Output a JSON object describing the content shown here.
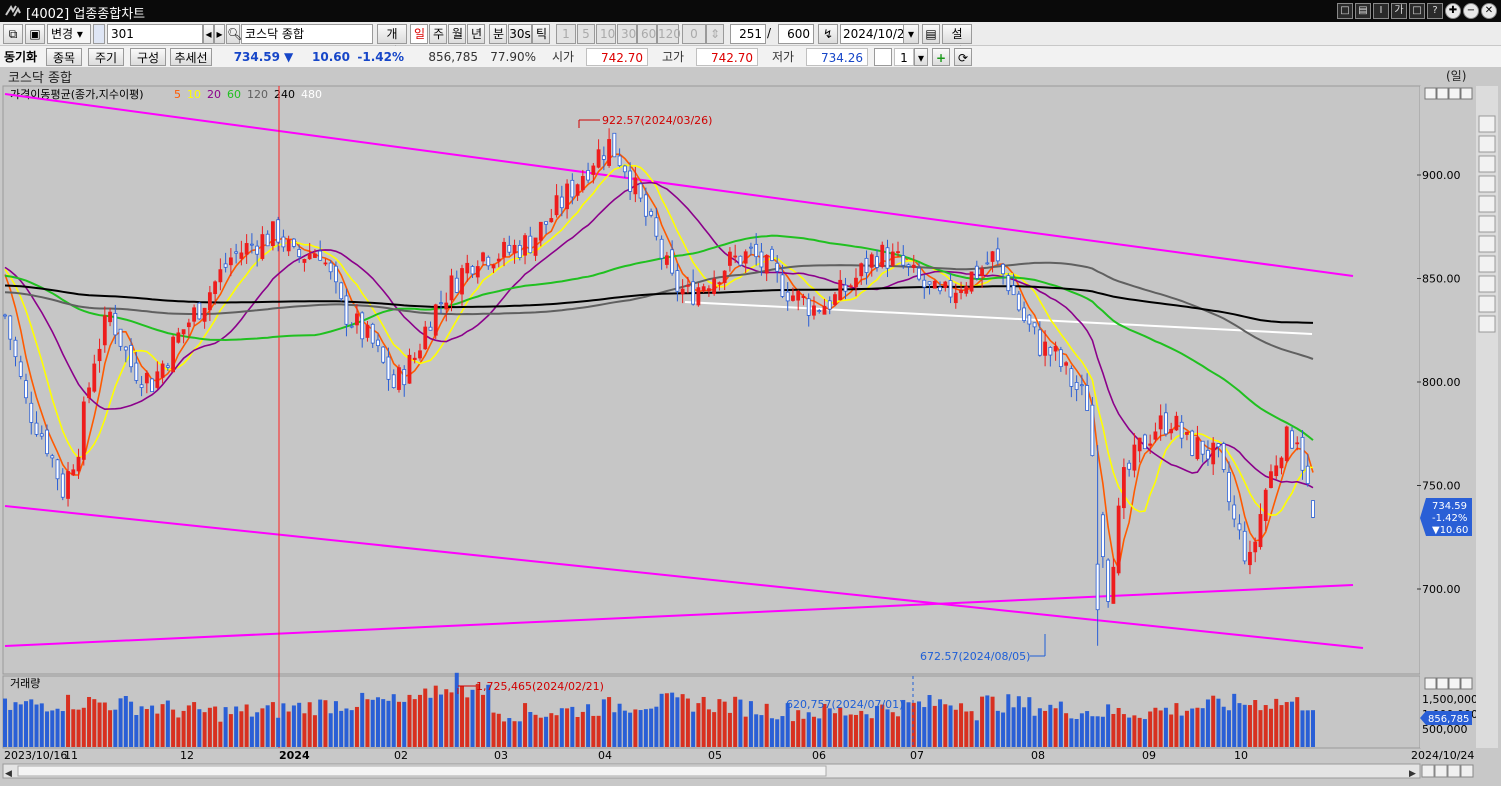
{
  "window": {
    "title": "[4002] 업종종합차트",
    "buttons": [
      "□",
      "▤",
      "Ⅰ",
      "가",
      "□",
      "?"
    ]
  },
  "toolbar": {
    "mode_label": "변경",
    "code_value": "301",
    "index_name": "코스닥 종합",
    "individual_label": "개별",
    "periods": [
      "일",
      "주",
      "월",
      "년",
      "분",
      "30s",
      "틱"
    ],
    "active_period": "일",
    "intervals": [
      "1",
      "5",
      "10",
      "30",
      "60",
      "120"
    ],
    "count_zero": "0",
    "count_display": "251",
    "count_total": "600",
    "date_value": "2024/10/24",
    "settings_label": "설정"
  },
  "quote_bar": {
    "sync_label": "동기화",
    "item_button": "종목",
    "period_button": "주기",
    "compose_button": "구성",
    "trendline_button": "추세선",
    "price": "734.59",
    "direction": "▼",
    "change": "10.60",
    "change_pct": "-1.42%",
    "volume": "856,785",
    "ratio": "77.90%",
    "open_label": "시가",
    "open": "742.70",
    "high_label": "고가",
    "high": "742.70",
    "low_label": "저가",
    "low": "734.26",
    "multiplier": "1"
  },
  "chart_header": {
    "title": "코스닥 종합",
    "unit": "(일)",
    "ma_legend_label": "가격이동평균(종가,지수이평)",
    "ma_periods": [
      {
        "label": "5",
        "color": "#ff5a00"
      },
      {
        "label": "10",
        "color": "#ffff00"
      },
      {
        "label": "20",
        "color": "#8b008b"
      },
      {
        "label": "60",
        "color": "#20c020"
      },
      {
        "label": "120",
        "color": "#606060"
      },
      {
        "label": "240",
        "color": "#000000"
      },
      {
        "label": "480",
        "color": "#ffffff"
      }
    ],
    "volume_label": "거래량"
  },
  "chart_data": {
    "type": "candlestick",
    "price_ylim": [
      665,
      930
    ],
    "price_ticks": [
      "900.00",
      "850.00",
      "800.00",
      "750.00",
      "700.00"
    ],
    "volume_ticks": [
      "1,500,000",
      "1,000,000",
      "500,000"
    ],
    "x_labels": [
      "2023/10/16",
      "11",
      "12",
      "2024",
      "02",
      "03",
      "04",
      "05",
      "06",
      "07",
      "08",
      "09",
      "10"
    ],
    "x_end_label": "2024/10/24",
    "annotations": [
      {
        "text": "922.57(2024/03/26)",
        "color": "#d00000"
      },
      {
        "text": "672.57(2024/08/05)",
        "color": "#1f5fd6"
      },
      {
        "text": "1,725,465(2024/02/21)",
        "color": "#d00000"
      },
      {
        "text": "620,757(2024/07/01)",
        "color": "#1f5fd6"
      }
    ],
    "last_price_box": [
      "734.59",
      "-1.42%",
      "▼10.60"
    ],
    "last_volume_box": "856,785",
    "monthly_closes": [
      {
        "x": "2023/10/16",
        "close": 790
      },
      {
        "x": "2023/11",
        "close": 805
      },
      {
        "x": "2023/12",
        "close": 866
      },
      {
        "x": "2024/01",
        "close": 830
      },
      {
        "x": "2024/02",
        "close": 862
      },
      {
        "x": "2024/03",
        "close": 905
      },
      {
        "x": "2024/04",
        "close": 868
      },
      {
        "x": "2024/05",
        "close": 846
      },
      {
        "x": "2024/06",
        "close": 840
      },
      {
        "x": "2024/07",
        "close": 809
      },
      {
        "x": "2024/08",
        "close": 767
      },
      {
        "x": "2024/09",
        "close": 765
      },
      {
        "x": "2024/10/24",
        "close": 734.59
      }
    ],
    "key_levels": [
      {
        "label": "high",
        "value": 922.57,
        "date": "2024/03/26"
      },
      {
        "label": "low",
        "value": 672.57,
        "date": "2024/08/05"
      }
    ]
  }
}
